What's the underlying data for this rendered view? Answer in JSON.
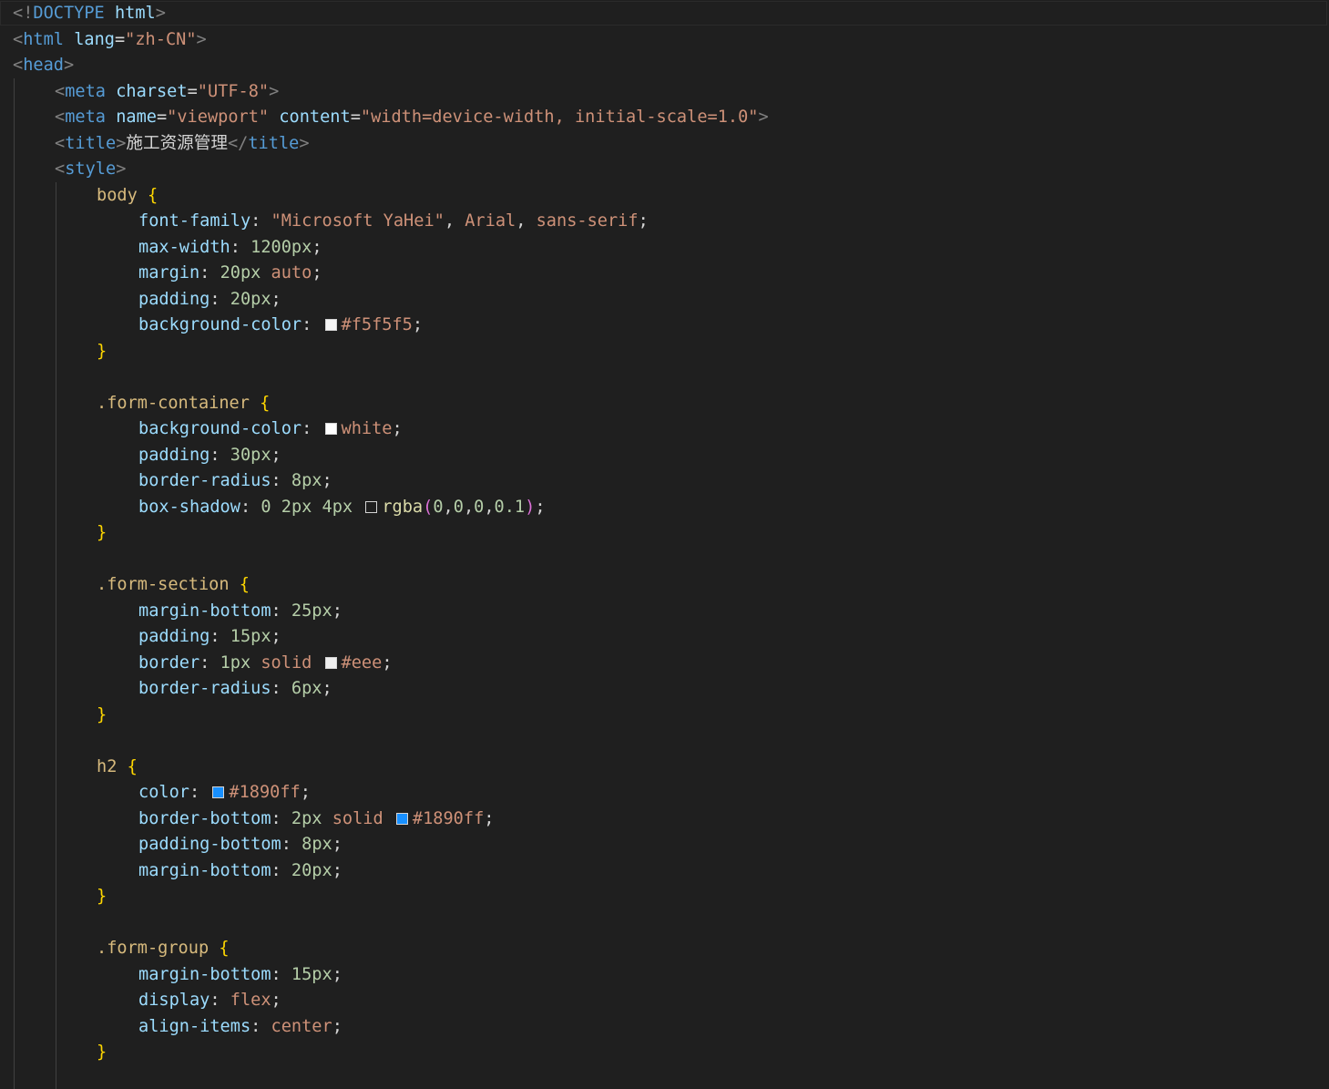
{
  "editor": {
    "language": "html",
    "theme_colors": {
      "background": "#1f1f1f",
      "tag_punctuation": "#808080",
      "tag_name": "#569cd6",
      "attribute": "#9cdcfe",
      "string": "#ce9178",
      "selector": "#d7ba7d",
      "brace": "#ffd700",
      "number": "#b5cea8",
      "function": "#dcdcaa",
      "paren": "#da70d6"
    },
    "lines": [
      {
        "indent": 0,
        "tokens": [
          [
            "punct",
            "<!"
          ],
          [
            "tag",
            "DOCTYPE"
          ],
          [
            "plain",
            " "
          ],
          [
            "attr",
            "html"
          ],
          [
            "punct",
            ">"
          ]
        ]
      },
      {
        "indent": 0,
        "tokens": [
          [
            "punct",
            "<"
          ],
          [
            "tag",
            "html"
          ],
          [
            "plain",
            " "
          ],
          [
            "attr",
            "lang"
          ],
          [
            "plain",
            "="
          ],
          [
            "str",
            "\"zh-CN\""
          ],
          [
            "punct",
            ">"
          ]
        ]
      },
      {
        "indent": 0,
        "tokens": [
          [
            "punct",
            "<"
          ],
          [
            "tag",
            "head"
          ],
          [
            "punct",
            ">"
          ]
        ]
      },
      {
        "indent": 1,
        "tokens": [
          [
            "punct",
            "<"
          ],
          [
            "tag",
            "meta"
          ],
          [
            "plain",
            " "
          ],
          [
            "attr",
            "charset"
          ],
          [
            "plain",
            "="
          ],
          [
            "str",
            "\"UTF-8\""
          ],
          [
            "punct",
            ">"
          ]
        ]
      },
      {
        "indent": 1,
        "tokens": [
          [
            "punct",
            "<"
          ],
          [
            "tag",
            "meta"
          ],
          [
            "plain",
            " "
          ],
          [
            "attr",
            "name"
          ],
          [
            "plain",
            "="
          ],
          [
            "str",
            "\"viewport\""
          ],
          [
            "plain",
            " "
          ],
          [
            "attr",
            "content"
          ],
          [
            "plain",
            "="
          ],
          [
            "str",
            "\"width=device-width, initial-scale=1.0\""
          ],
          [
            "punct",
            ">"
          ]
        ]
      },
      {
        "indent": 1,
        "tokens": [
          [
            "punct",
            "<"
          ],
          [
            "tag",
            "title"
          ],
          [
            "punct",
            ">"
          ],
          [
            "cjk",
            "施工资源管理"
          ],
          [
            "punct",
            "</"
          ],
          [
            "tag",
            "title"
          ],
          [
            "punct",
            ">"
          ]
        ]
      },
      {
        "indent": 1,
        "tokens": [
          [
            "punct",
            "<"
          ],
          [
            "tag",
            "style"
          ],
          [
            "punct",
            ">"
          ]
        ]
      },
      {
        "indent": 2,
        "tokens": [
          [
            "sel",
            "body"
          ],
          [
            "plain",
            " "
          ],
          [
            "brace",
            "{"
          ]
        ]
      },
      {
        "indent": 3,
        "tokens": [
          [
            "prop",
            "font-family"
          ],
          [
            "plain",
            ": "
          ],
          [
            "str",
            "\"Microsoft YaHei\""
          ],
          [
            "plain",
            ", "
          ],
          [
            "kw",
            "Arial"
          ],
          [
            "plain",
            ", "
          ],
          [
            "kw",
            "sans-serif"
          ],
          [
            "plain",
            ";"
          ]
        ]
      },
      {
        "indent": 3,
        "tokens": [
          [
            "prop",
            "max-width"
          ],
          [
            "plain",
            ": "
          ],
          [
            "num",
            "1200px"
          ],
          [
            "plain",
            ";"
          ]
        ]
      },
      {
        "indent": 3,
        "tokens": [
          [
            "prop",
            "margin"
          ],
          [
            "plain",
            ": "
          ],
          [
            "num",
            "20px"
          ],
          [
            "plain",
            " "
          ],
          [
            "kw",
            "auto"
          ],
          [
            "plain",
            ";"
          ]
        ]
      },
      {
        "indent": 3,
        "tokens": [
          [
            "prop",
            "padding"
          ],
          [
            "plain",
            ": "
          ],
          [
            "num",
            "20px"
          ],
          [
            "plain",
            ";"
          ]
        ]
      },
      {
        "indent": 3,
        "tokens": [
          [
            "prop",
            "background-color"
          ],
          [
            "plain",
            ": "
          ],
          [
            "swatch",
            "#f5f5f5"
          ],
          [
            "kw",
            "#f5f5f5"
          ],
          [
            "plain",
            ";"
          ]
        ]
      },
      {
        "indent": 2,
        "tokens": [
          [
            "brace",
            "}"
          ]
        ]
      },
      {
        "indent": 0,
        "tokens": []
      },
      {
        "indent": 2,
        "tokens": [
          [
            "sel",
            ".form-container"
          ],
          [
            "plain",
            " "
          ],
          [
            "brace",
            "{"
          ]
        ]
      },
      {
        "indent": 3,
        "tokens": [
          [
            "prop",
            "background-color"
          ],
          [
            "plain",
            ": "
          ],
          [
            "swatch",
            "#ffffff"
          ],
          [
            "kw",
            "white"
          ],
          [
            "plain",
            ";"
          ]
        ]
      },
      {
        "indent": 3,
        "tokens": [
          [
            "prop",
            "padding"
          ],
          [
            "plain",
            ": "
          ],
          [
            "num",
            "30px"
          ],
          [
            "plain",
            ";"
          ]
        ]
      },
      {
        "indent": 3,
        "tokens": [
          [
            "prop",
            "border-radius"
          ],
          [
            "plain",
            ": "
          ],
          [
            "num",
            "8px"
          ],
          [
            "plain",
            ";"
          ]
        ]
      },
      {
        "indent": 3,
        "tokens": [
          [
            "prop",
            "box-shadow"
          ],
          [
            "plain",
            ": "
          ],
          [
            "num",
            "0"
          ],
          [
            "plain",
            " "
          ],
          [
            "num",
            "2px"
          ],
          [
            "plain",
            " "
          ],
          [
            "num",
            "4px"
          ],
          [
            "plain",
            " "
          ],
          [
            "swatch",
            "#000000"
          ],
          [
            "func",
            "rgba"
          ],
          [
            "paren",
            "("
          ],
          [
            "num",
            "0"
          ],
          [
            "plain",
            ","
          ],
          [
            "num",
            "0"
          ],
          [
            "plain",
            ","
          ],
          [
            "num",
            "0"
          ],
          [
            "plain",
            ","
          ],
          [
            "num",
            "0.1"
          ],
          [
            "paren",
            ")"
          ],
          [
            "plain",
            ";"
          ]
        ]
      },
      {
        "indent": 2,
        "tokens": [
          [
            "brace",
            "}"
          ]
        ]
      },
      {
        "indent": 0,
        "tokens": []
      },
      {
        "indent": 2,
        "tokens": [
          [
            "sel",
            ".form-section"
          ],
          [
            "plain",
            " "
          ],
          [
            "brace",
            "{"
          ]
        ]
      },
      {
        "indent": 3,
        "tokens": [
          [
            "prop",
            "margin-bottom"
          ],
          [
            "plain",
            ": "
          ],
          [
            "num",
            "25px"
          ],
          [
            "plain",
            ";"
          ]
        ]
      },
      {
        "indent": 3,
        "tokens": [
          [
            "prop",
            "padding"
          ],
          [
            "plain",
            ": "
          ],
          [
            "num",
            "15px"
          ],
          [
            "plain",
            ";"
          ]
        ]
      },
      {
        "indent": 3,
        "tokens": [
          [
            "prop",
            "border"
          ],
          [
            "plain",
            ": "
          ],
          [
            "num",
            "1px"
          ],
          [
            "plain",
            " "
          ],
          [
            "kw",
            "solid"
          ],
          [
            "plain",
            " "
          ],
          [
            "swatch",
            "#eeeeee"
          ],
          [
            "kw",
            "#eee"
          ],
          [
            "plain",
            ";"
          ]
        ]
      },
      {
        "indent": 3,
        "tokens": [
          [
            "prop",
            "border-radius"
          ],
          [
            "plain",
            ": "
          ],
          [
            "num",
            "6px"
          ],
          [
            "plain",
            ";"
          ]
        ]
      },
      {
        "indent": 2,
        "tokens": [
          [
            "brace",
            "}"
          ]
        ]
      },
      {
        "indent": 0,
        "tokens": []
      },
      {
        "indent": 2,
        "tokens": [
          [
            "sel",
            "h2"
          ],
          [
            "plain",
            " "
          ],
          [
            "brace",
            "{"
          ]
        ]
      },
      {
        "indent": 3,
        "tokens": [
          [
            "prop",
            "color"
          ],
          [
            "plain",
            ": "
          ],
          [
            "swatch",
            "#1890ff"
          ],
          [
            "kw",
            "#1890ff"
          ],
          [
            "plain",
            ";"
          ]
        ]
      },
      {
        "indent": 3,
        "tokens": [
          [
            "prop",
            "border-bottom"
          ],
          [
            "plain",
            ": "
          ],
          [
            "num",
            "2px"
          ],
          [
            "plain",
            " "
          ],
          [
            "kw",
            "solid"
          ],
          [
            "plain",
            " "
          ],
          [
            "swatch",
            "#1890ff"
          ],
          [
            "kw",
            "#1890ff"
          ],
          [
            "plain",
            ";"
          ]
        ]
      },
      {
        "indent": 3,
        "tokens": [
          [
            "prop",
            "padding-bottom"
          ],
          [
            "plain",
            ": "
          ],
          [
            "num",
            "8px"
          ],
          [
            "plain",
            ";"
          ]
        ]
      },
      {
        "indent": 3,
        "tokens": [
          [
            "prop",
            "margin-bottom"
          ],
          [
            "plain",
            ": "
          ],
          [
            "num",
            "20px"
          ],
          [
            "plain",
            ";"
          ]
        ]
      },
      {
        "indent": 2,
        "tokens": [
          [
            "brace",
            "}"
          ]
        ]
      },
      {
        "indent": 0,
        "tokens": []
      },
      {
        "indent": 2,
        "tokens": [
          [
            "sel",
            ".form-group"
          ],
          [
            "plain",
            " "
          ],
          [
            "brace",
            "{"
          ]
        ]
      },
      {
        "indent": 3,
        "tokens": [
          [
            "prop",
            "margin-bottom"
          ],
          [
            "plain",
            ": "
          ],
          [
            "num",
            "15px"
          ],
          [
            "plain",
            ";"
          ]
        ]
      },
      {
        "indent": 3,
        "tokens": [
          [
            "prop",
            "display"
          ],
          [
            "plain",
            ": "
          ],
          [
            "kw",
            "flex"
          ],
          [
            "plain",
            ";"
          ]
        ]
      },
      {
        "indent": 3,
        "tokens": [
          [
            "prop",
            "align-items"
          ],
          [
            "plain",
            ": "
          ],
          [
            "kw",
            "center"
          ],
          [
            "plain",
            ";"
          ]
        ]
      },
      {
        "indent": 2,
        "tokens": [
          [
            "brace",
            "}"
          ]
        ]
      },
      {
        "indent": 0,
        "tokens": []
      }
    ]
  }
}
